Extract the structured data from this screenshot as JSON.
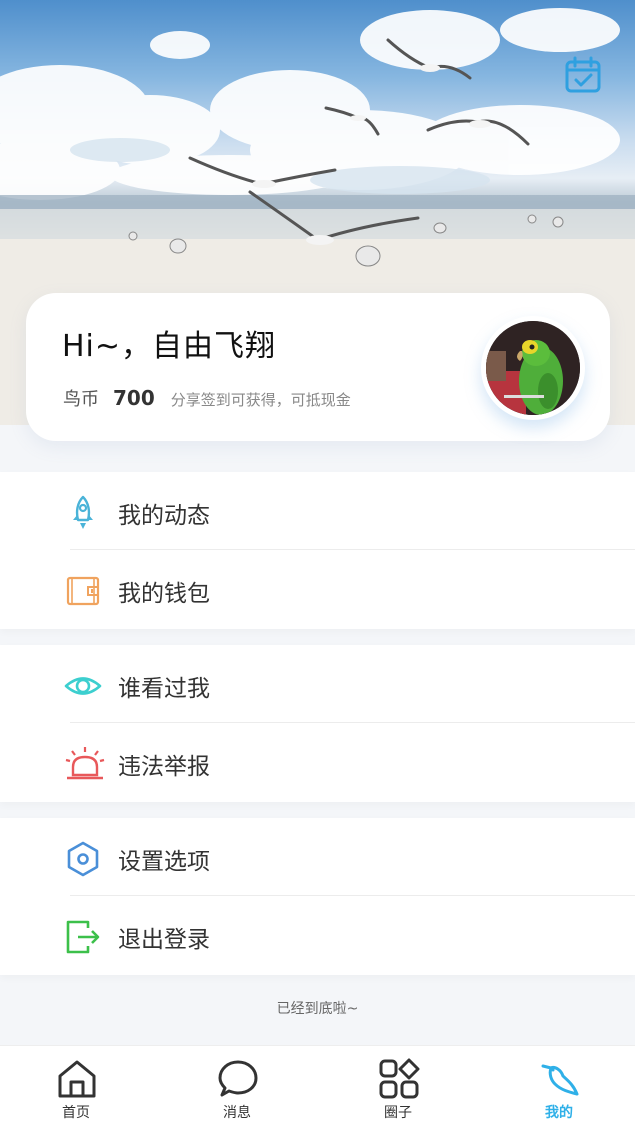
{
  "profile": {
    "greeting": "Hi~，自由飞翔",
    "coin_label": "鸟币",
    "coin_value": "700",
    "coin_hint": "分享签到可获得，可抵现金"
  },
  "menu_groups": [
    {
      "items": [
        {
          "label": "我的动态",
          "icon": "rocket-icon"
        },
        {
          "label": "我的钱包",
          "icon": "wallet-icon"
        }
      ]
    },
    {
      "items": [
        {
          "label": "谁看过我",
          "icon": "eye-icon"
        },
        {
          "label": "违法举报",
          "icon": "alarm-icon"
        }
      ]
    },
    {
      "items": [
        {
          "label": "设置选项",
          "icon": "settings-hexagon-icon"
        },
        {
          "label": "退出登录",
          "icon": "logout-icon"
        }
      ]
    }
  ],
  "footer_hint": "已经到底啦~",
  "tabs": [
    {
      "label": "首页",
      "icon": "home-icon"
    },
    {
      "label": "消息",
      "icon": "message-icon"
    },
    {
      "label": "圈子",
      "icon": "circles-icon"
    },
    {
      "label": "我的",
      "icon": "bird-icon",
      "active": true
    }
  ],
  "colors": {
    "accent": "#2fb0e8",
    "rocket": "#4ab3d8",
    "wallet": "#f0a35e",
    "eye": "#3ccfcf",
    "alarm": "#e8585a",
    "settings": "#4a8fd8",
    "logout": "#3cc04a"
  }
}
